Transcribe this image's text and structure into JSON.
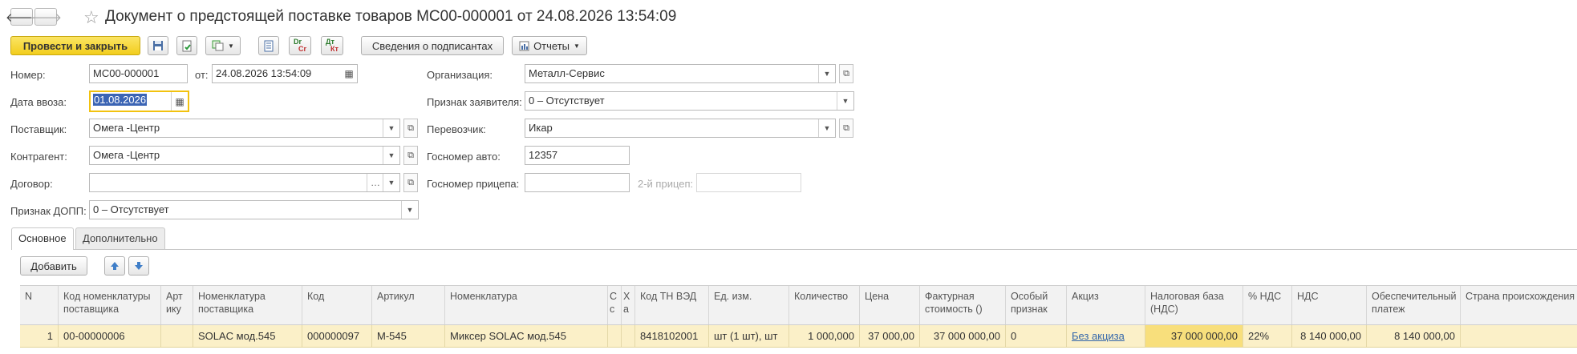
{
  "window": {
    "title": "Документ о предстоящей поставке товаров МС00-000001 от 24.08.2026 13:54:09"
  },
  "toolbar": {
    "post_close": "Провести и закрыть",
    "signers": "Сведения о подписантах",
    "reports": "Отчеты"
  },
  "form": {
    "number_label": "Номер:",
    "number_value": "МС00-000001",
    "from_label": "от:",
    "from_value": "24.08.2026 13:54:09",
    "import_date_label": "Дата ввоза:",
    "import_date_value": "01.08.2026",
    "supplier_label": "Поставщик:",
    "supplier_value": "Омега -Центр",
    "counterparty_label": "Контрагент:",
    "counterparty_value": "Омега -Центр",
    "contract_label": "Договор:",
    "contract_value": "",
    "dopp_label": "Признак ДОПП:",
    "dopp_value": "0 – Отсутствует",
    "org_label": "Организация:",
    "org_value": "Металл-Сервис",
    "applicant_label": "Признак заявителя:",
    "applicant_value": "0 – Отсутствует",
    "carrier_label": "Перевозчик:",
    "carrier_value": "Икар",
    "truck_label": "Госномер авто:",
    "truck_value": "12357",
    "trailer_label": "Госномер прицепа:",
    "trailer_value": "",
    "trailer2_label": "2-й прицеп:",
    "trailer2_value": ""
  },
  "tabs": [
    {
      "label": "Основное"
    },
    {
      "label": "Дополнительно"
    }
  ],
  "table": {
    "add_label": "Добавить",
    "headers": {
      "n": "N",
      "supplier_code": "Код номенклатуры поставщика",
      "art_short": "Арт ику",
      "supplier_nom": "Номенклатура поставщика",
      "code": "Код",
      "article": "Артикул",
      "nomenclature": "Номенклатура",
      "c1": "С с",
      "c2": "Х а",
      "tnved": "Код ТН ВЭД",
      "unit": "Ед. изм.",
      "qty": "Количество",
      "price": "Цена",
      "invoice": "Фактурная стоимость ()",
      "special": "Особый признак",
      "excise": "Акциз",
      "taxbase": "Налоговая база (НДС)",
      "vat_rate": "% НДС",
      "vat": "НДС",
      "deposit": "Обеспечительный платеж",
      "country": "Страна происхождения"
    },
    "rows": [
      {
        "n": "1",
        "supplier_code": "00-00000006",
        "art_short": "",
        "supplier_nom": "SOLAC мод.545",
        "code": "000000097",
        "article": "M-545",
        "nomenclature": "Миксер SOLAC мод.545",
        "c1": "",
        "c2": "",
        "tnved": "8418102001",
        "unit": "шт (1 шт), шт",
        "qty": "1 000,000",
        "price": "37 000,00",
        "invoice": "37 000 000,00",
        "special": "0",
        "excise": "Без акциза",
        "taxbase": "37 000 000,00",
        "vat_rate": "22%",
        "vat": "8 140 000,00",
        "deposit": "8 140 000,00",
        "country": ""
      }
    ]
  }
}
